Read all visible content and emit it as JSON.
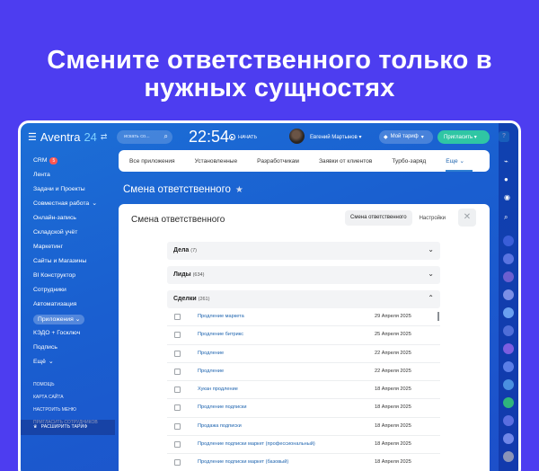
{
  "headline": {
    "line1": "Смените ответственного только в",
    "line2": "нужных сущностях"
  },
  "topbar": {
    "logo_text": "Aventra",
    "logo_num": "24",
    "search_placeholder": "искать со...",
    "clock": "22:54",
    "start_label": "НАЧАТЬ",
    "user_name": "Евгений Мартынов",
    "plan_label": "Мой тариф",
    "invite_label": "Пригласить"
  },
  "sidebar": {
    "items": [
      {
        "label": "CRM",
        "badge": "5"
      },
      {
        "label": "Лента"
      },
      {
        "label": "Задачи и Проекты"
      },
      {
        "label": "Совместная работа"
      },
      {
        "label": "Онлайн-запись"
      },
      {
        "label": "Складской учёт"
      },
      {
        "label": "Маркетинг"
      },
      {
        "label": "Сайты и Магазины"
      },
      {
        "label": "BI Конструктор"
      },
      {
        "label": "Сотрудники"
      },
      {
        "label": "Автоматизация"
      },
      {
        "label": "Приложения"
      },
      {
        "label": "КЭДО + Госключ"
      },
      {
        "label": "Подпись"
      },
      {
        "label": "Ещё"
      }
    ],
    "small_links": [
      "ПОМОЩЬ",
      "КАРТА САЙТА",
      "НАСТРОИТЬ МЕНЮ",
      "ПРИГЛАСИТЬ СОТРУДНИКОВ"
    ],
    "expand_label": "РАСШИРИТЬ ТАРИФ"
  },
  "nav_tabs": [
    "Все приложения",
    "Установленные",
    "Разработчикам",
    "Заявки от клиентов",
    "Турбо-заряд",
    "Еще"
  ],
  "page_title": "Смена ответственного",
  "panel": {
    "title": "Смена ответственного",
    "tab_active": "Смена ответственного",
    "tab_other": "Настройки",
    "sections": [
      {
        "label": "Дела",
        "count": "(7)"
      },
      {
        "label": "Лиды",
        "count": "(634)"
      },
      {
        "label": "Сделки",
        "count": "(261)"
      }
    ],
    "rows": [
      {
        "name": "Продление маркета",
        "date": "29 Апреля 2025"
      },
      {
        "name": "Продление битрикс",
        "date": "25 Апреля 2025"
      },
      {
        "name": "Продление",
        "date": "22 Апреля 2025"
      },
      {
        "name": "Продление",
        "date": "22 Апреля 2025"
      },
      {
        "name": "Хукан продление",
        "date": "18 Апреля 2025"
      },
      {
        "name": "Продление подписки",
        "date": "18 Апреля 2025"
      },
      {
        "name": "Продажа подписки",
        "date": "18 Апреля 2025"
      },
      {
        "name": "Продление подписки маркет (профессиональный)",
        "date": "18 Апреля 2025"
      },
      {
        "name": "Продление подписки маркет (базовый)",
        "date": "18 Апреля 2025"
      }
    ]
  }
}
